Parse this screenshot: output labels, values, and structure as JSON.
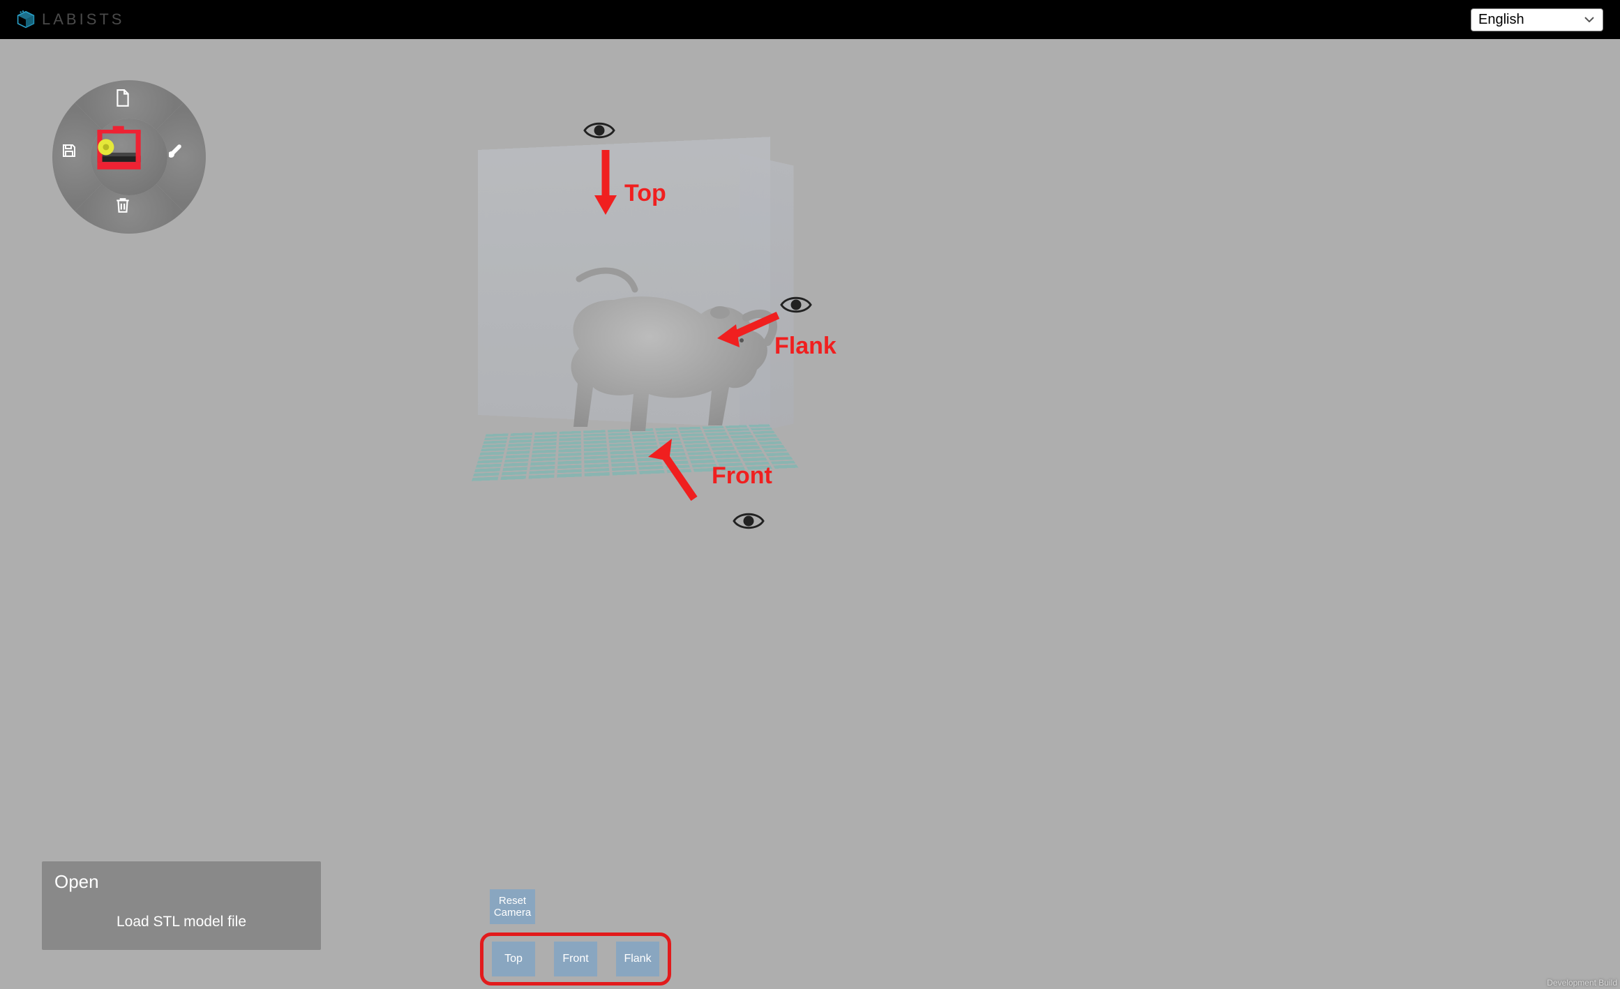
{
  "header": {
    "brand": "LABISTS",
    "language_selected": "English"
  },
  "radial": {
    "top_icon": "file-icon",
    "right_icon": "brush-icon",
    "bottom_icon": "trash-icon",
    "left_icon": "save-icon",
    "center_icon": "printer-icon"
  },
  "open_panel": {
    "title": "Open",
    "subtitle": "Load STL model file"
  },
  "camera": {
    "reset_label": "Reset\nCamera",
    "views": [
      "Top",
      "Front",
      "Flank"
    ]
  },
  "annotations": {
    "top": "Top",
    "flank": "Flank",
    "front": "Front"
  },
  "footer": {
    "dev_build": "Development Build"
  }
}
